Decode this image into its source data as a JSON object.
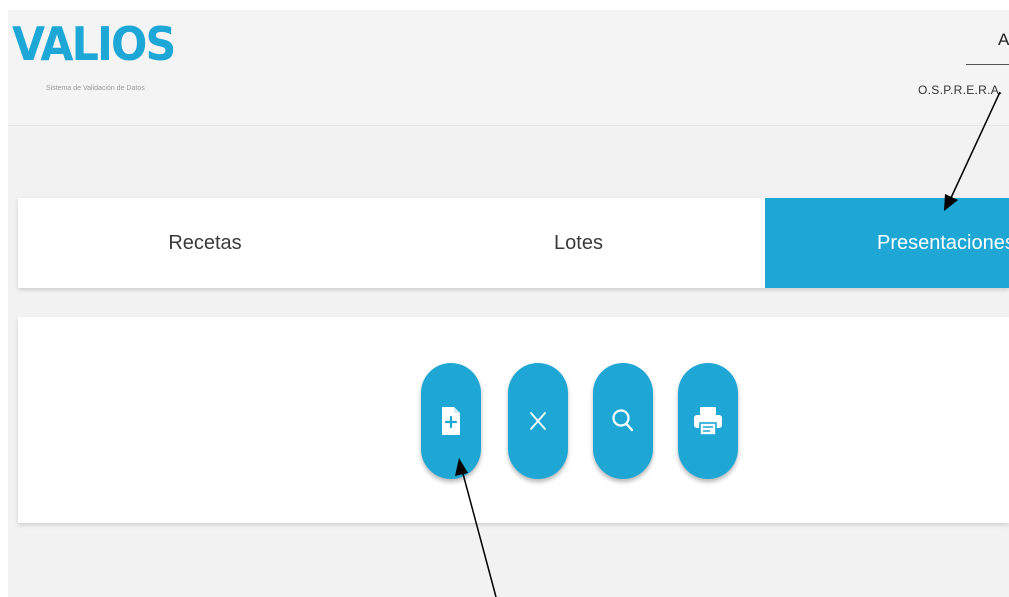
{
  "header": {
    "logo_text": "VALIOS",
    "logo_subtitle": "Sistema de Validación de Datos",
    "user_name": "A",
    "organization": "O.S.P.R.E.R.A."
  },
  "tabs": [
    {
      "label": "Recetas",
      "active": false
    },
    {
      "label": "Lotes",
      "active": false
    },
    {
      "label": "Presentaciones",
      "active": true
    }
  ],
  "toolbar": {
    "buttons": [
      {
        "icon": "new-document-icon",
        "action": "Nuevo"
      },
      {
        "icon": "close-icon",
        "action": "Cancelar"
      },
      {
        "icon": "search-icon",
        "action": "Buscar"
      },
      {
        "icon": "printer-icon",
        "action": "Imprimir"
      }
    ]
  },
  "colors": {
    "accent": "#1ea7d5",
    "logo": "#1da7d6",
    "background": "#f2f2f2"
  }
}
